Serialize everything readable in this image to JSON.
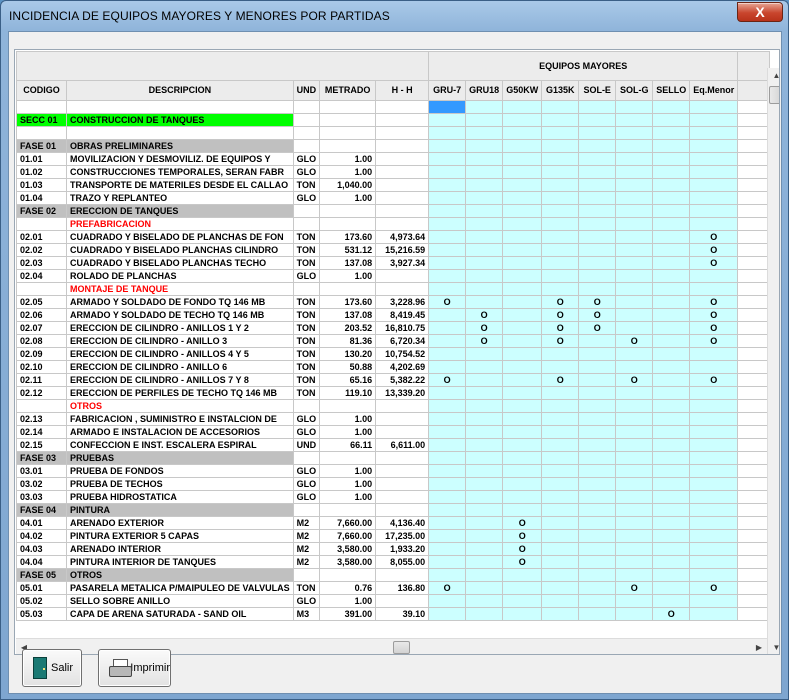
{
  "window": {
    "title": "INCIDENCIA DE EQUIPOS MAYORES Y MENORES POR PARTIDAS",
    "close_label": "X"
  },
  "grid": {
    "group_header": "EQUIPOS MAYORES",
    "columns": [
      "CODIGO",
      "DESCRIPCION",
      "UND",
      "METRADO",
      "H - H",
      "GRU-7",
      "GRU18",
      "G50KW",
      "G135K",
      "SOL-E",
      "SOL-G",
      "SELLO",
      "Eq.Menor"
    ],
    "rows": [
      {
        "type": "blank",
        "code": "",
        "desc": "",
        "und": "",
        "metrado": "",
        "hh": "",
        "eq": [
          "",
          "",
          "",
          "",
          "",
          "",
          "",
          ""
        ]
      },
      {
        "type": "secc",
        "code": "SECC 01",
        "desc": "CONSTRUCCION DE TANQUES",
        "und": "",
        "metrado": "",
        "hh": "",
        "eq": [
          "",
          "",
          "",
          "",
          "",
          "",
          "",
          ""
        ]
      },
      {
        "type": "blank",
        "code": "",
        "desc": "",
        "und": "",
        "metrado": "",
        "hh": "",
        "eq": [
          "",
          "",
          "",
          "",
          "",
          "",
          "",
          ""
        ]
      },
      {
        "type": "fase",
        "code": "FASE 01",
        "desc": "OBRAS PRELIMINARES",
        "und": "",
        "metrado": "",
        "hh": "",
        "eq": [
          "",
          "",
          "",
          "",
          "",
          "",
          "",
          ""
        ]
      },
      {
        "type": "item",
        "code": "01.01",
        "desc": "MOVILIZACION Y DESMOVILIZ. DE EQUIPOS Y",
        "und": "GLO",
        "metrado": "1.00",
        "hh": "",
        "eq": [
          "",
          "",
          "",
          "",
          "",
          "",
          "",
          ""
        ]
      },
      {
        "type": "item",
        "code": "01.02",
        "desc": "CONSTRUCCIONES TEMPORALES, SERAN FABR",
        "und": "GLO",
        "metrado": "1.00",
        "hh": "",
        "eq": [
          "",
          "",
          "",
          "",
          "",
          "",
          "",
          ""
        ]
      },
      {
        "type": "item",
        "code": "01.03",
        "desc": "TRANSPORTE DE MATERILES DESDE EL CALLAO",
        "und": "TON",
        "metrado": "1,040.00",
        "hh": "",
        "eq": [
          "",
          "",
          "",
          "",
          "",
          "",
          "",
          ""
        ]
      },
      {
        "type": "item",
        "code": "01.04",
        "desc": "TRAZO Y REPLANTEO",
        "und": "GLO",
        "metrado": "1.00",
        "hh": "",
        "eq": [
          "",
          "",
          "",
          "",
          "",
          "",
          "",
          ""
        ]
      },
      {
        "type": "fase",
        "code": "FASE 02",
        "desc": "ERECCION DE TANQUES",
        "und": "",
        "metrado": "",
        "hh": "",
        "eq": [
          "",
          "",
          "",
          "",
          "",
          "",
          "",
          ""
        ]
      },
      {
        "type": "sub",
        "code": "",
        "desc": "PREFABRICACION",
        "und": "",
        "metrado": "",
        "hh": "",
        "eq": [
          "",
          "",
          "",
          "",
          "",
          "",
          "",
          ""
        ]
      },
      {
        "type": "item",
        "code": "02.01",
        "desc": "CUADRADO Y BISELADO DE PLANCHAS DE FON",
        "und": "TON",
        "metrado": "173.60",
        "hh": "4,973.64",
        "eq": [
          "",
          "",
          "",
          "",
          "",
          "",
          "",
          "O"
        ]
      },
      {
        "type": "item",
        "code": "02.02",
        "desc": "CUADRADO Y BISELADO PLANCHAS CILINDRO",
        "und": "TON",
        "metrado": "531.12",
        "hh": "15,216.59",
        "eq": [
          "",
          "",
          "",
          "",
          "",
          "",
          "",
          "O"
        ]
      },
      {
        "type": "item",
        "code": "02.03",
        "desc": "CUADRADO Y BISELADO PLANCHAS TECHO",
        "und": "TON",
        "metrado": "137.08",
        "hh": "3,927.34",
        "eq": [
          "",
          "",
          "",
          "",
          "",
          "",
          "",
          "O"
        ]
      },
      {
        "type": "item",
        "code": "02.04",
        "desc": "ROLADO DE PLANCHAS",
        "und": "GLO",
        "metrado": "1.00",
        "hh": "",
        "eq": [
          "",
          "",
          "",
          "",
          "",
          "",
          "",
          ""
        ]
      },
      {
        "type": "sub",
        "code": "",
        "desc": "MONTAJE DE TANQUE",
        "und": "",
        "metrado": "",
        "hh": "",
        "eq": [
          "",
          "",
          "",
          "",
          "",
          "",
          "",
          ""
        ]
      },
      {
        "type": "item",
        "code": "02.05",
        "desc": "ARMADO Y SOLDADO DE FONDO TQ 146 MB",
        "und": "TON",
        "metrado": "173.60",
        "hh": "3,228.96",
        "eq": [
          "O",
          "",
          "",
          "O",
          "O",
          "",
          "",
          "O"
        ]
      },
      {
        "type": "item",
        "code": "02.06",
        "desc": "ARMADO Y SOLDADO DE TECHO TQ 146 MB",
        "und": "TON",
        "metrado": "137.08",
        "hh": "8,419.45",
        "eq": [
          "",
          "O",
          "",
          "O",
          "O",
          "",
          "",
          "O"
        ]
      },
      {
        "type": "item",
        "code": "02.07",
        "desc": "ERECCION DE CILINDRO - ANILLOS 1 Y 2",
        "und": "TON",
        "metrado": "203.52",
        "hh": "16,810.75",
        "eq": [
          "",
          "O",
          "",
          "O",
          "O",
          "",
          "",
          "O"
        ]
      },
      {
        "type": "item",
        "code": "02.08",
        "desc": "ERECCION DE CILINDRO - ANILLO 3",
        "und": "TON",
        "metrado": "81.36",
        "hh": "6,720.34",
        "eq": [
          "",
          "O",
          "",
          "O",
          "",
          "O",
          "",
          "O"
        ]
      },
      {
        "type": "item",
        "code": "02.09",
        "desc": "ERECCION DE CILINDRO - ANILLOS 4 Y 5",
        "und": "TON",
        "metrado": "130.20",
        "hh": "10,754.52",
        "eq": [
          "",
          "",
          "",
          "",
          "",
          "",
          "",
          ""
        ]
      },
      {
        "type": "item",
        "code": "02.10",
        "desc": "ERECCION DE CILINDRO - ANILLO 6",
        "und": "TON",
        "metrado": "50.88",
        "hh": "4,202.69",
        "eq": [
          "",
          "",
          "",
          "",
          "",
          "",
          "",
          ""
        ]
      },
      {
        "type": "item",
        "code": "02.11",
        "desc": "ERECCION DE CILINDRO - ANILLOS 7 Y 8",
        "und": "TON",
        "metrado": "65.16",
        "hh": "5,382.22",
        "eq": [
          "O",
          "",
          "",
          "O",
          "",
          "O",
          "",
          "O"
        ]
      },
      {
        "type": "item",
        "code": "02.12",
        "desc": "ERECCION DE PERFILES DE TECHO TQ 146 MB",
        "und": "TON",
        "metrado": "119.10",
        "hh": "13,339.20",
        "eq": [
          "",
          "",
          "",
          "",
          "",
          "",
          "",
          ""
        ]
      },
      {
        "type": "sub",
        "code": "",
        "desc": "OTROS",
        "und": "",
        "metrado": "",
        "hh": "",
        "eq": [
          "",
          "",
          "",
          "",
          "",
          "",
          "",
          ""
        ]
      },
      {
        "type": "item",
        "code": "02.13",
        "desc": "FABRICACION , SUMINISTRO E INSTALCION DE",
        "und": "GLO",
        "metrado": "1.00",
        "hh": "",
        "eq": [
          "",
          "",
          "",
          "",
          "",
          "",
          "",
          ""
        ]
      },
      {
        "type": "item",
        "code": "02.14",
        "desc": "ARMADO E INSTALACION DE ACCESORIOS",
        "und": "GLO",
        "metrado": "1.00",
        "hh": "",
        "eq": [
          "",
          "",
          "",
          "",
          "",
          "",
          "",
          ""
        ]
      },
      {
        "type": "item",
        "code": "02.15",
        "desc": "CONFECCION  E INST. ESCALERA ESPIRAL",
        "und": "UND",
        "metrado": "66.11",
        "hh": "6,611.00",
        "eq": [
          "",
          "",
          "",
          "",
          "",
          "",
          "",
          ""
        ]
      },
      {
        "type": "fase",
        "code": "FASE 03",
        "desc": "PRUEBAS",
        "und": "",
        "metrado": "",
        "hh": "",
        "eq": [
          "",
          "",
          "",
          "",
          "",
          "",
          "",
          ""
        ]
      },
      {
        "type": "item",
        "code": "03.01",
        "desc": "PRUEBA DE FONDOS",
        "und": "GLO",
        "metrado": "1.00",
        "hh": "",
        "eq": [
          "",
          "",
          "",
          "",
          "",
          "",
          "",
          ""
        ]
      },
      {
        "type": "item",
        "code": "03.02",
        "desc": "PRUEBA DE TECHOS",
        "und": "GLO",
        "metrado": "1.00",
        "hh": "",
        "eq": [
          "",
          "",
          "",
          "",
          "",
          "",
          "",
          ""
        ]
      },
      {
        "type": "item",
        "code": "03.03",
        "desc": "PRUEBA HIDROSTATICA",
        "und": "GLO",
        "metrado": "1.00",
        "hh": "",
        "eq": [
          "",
          "",
          "",
          "",
          "",
          "",
          "",
          ""
        ]
      },
      {
        "type": "fase",
        "code": "FASE 04",
        "desc": "PINTURA",
        "und": "",
        "metrado": "",
        "hh": "",
        "eq": [
          "",
          "",
          "",
          "",
          "",
          "",
          "",
          ""
        ]
      },
      {
        "type": "item",
        "code": "04.01",
        "desc": "ARENADO EXTERIOR",
        "und": "M2",
        "metrado": "7,660.00",
        "hh": "4,136.40",
        "eq": [
          "",
          "",
          "O",
          "",
          "",
          "",
          "",
          ""
        ]
      },
      {
        "type": "item",
        "code": "04.02",
        "desc": "PINTURA EXTERIOR 5 CAPAS",
        "und": "M2",
        "metrado": "7,660.00",
        "hh": "17,235.00",
        "eq": [
          "",
          "",
          "O",
          "",
          "",
          "",
          "",
          ""
        ]
      },
      {
        "type": "item",
        "code": "04.03",
        "desc": "ARENADO INTERIOR",
        "und": "M2",
        "metrado": "3,580.00",
        "hh": "1,933.20",
        "eq": [
          "",
          "",
          "O",
          "",
          "",
          "",
          "",
          ""
        ]
      },
      {
        "type": "item",
        "code": "04.04",
        "desc": "PINTURA INTERIOR DE TANQUES",
        "und": "M2",
        "metrado": "3,580.00",
        "hh": "8,055.00",
        "eq": [
          "",
          "",
          "O",
          "",
          "",
          "",
          "",
          ""
        ]
      },
      {
        "type": "fase",
        "code": "FASE 05",
        "desc": "OTROS",
        "und": "",
        "metrado": "",
        "hh": "",
        "eq": [
          "",
          "",
          "",
          "",
          "",
          "",
          "",
          ""
        ]
      },
      {
        "type": "item",
        "code": "05.01",
        "desc": "PASARELA METALICA P/MAIPULEO DE VALVULAS",
        "und": "TON",
        "metrado": "0.76",
        "hh": "136.80",
        "eq": [
          "O",
          "",
          "",
          "",
          "",
          "O",
          "",
          "O"
        ]
      },
      {
        "type": "item",
        "code": "05.02",
        "desc": "SELLO SOBRE ANILLO",
        "und": "GLO",
        "metrado": "1.00",
        "hh": "",
        "eq": [
          "",
          "",
          "",
          "",
          "",
          "",
          "",
          ""
        ]
      },
      {
        "type": "item",
        "code": "05.03",
        "desc": "CAPA DE ARENA SATURADA - SAND OIL",
        "und": "M3",
        "metrado": "391.00",
        "hh": "39.10",
        "eq": [
          "",
          "",
          "",
          "",
          "",
          "",
          "O",
          ""
        ]
      }
    ]
  },
  "buttons": {
    "salir": "Salir",
    "imprimir": "Imprimir"
  },
  "icons": {
    "close": "close-icon",
    "salir": "door-exit-icon",
    "imprimir": "printer-icon"
  },
  "colors": {
    "secc_row": "#00ff00",
    "fase_row": "#c0c0c0",
    "subtitle_text": "#ff0000",
    "equipment_cells": "#ccffff",
    "selected_cell": "#3399ff"
  }
}
